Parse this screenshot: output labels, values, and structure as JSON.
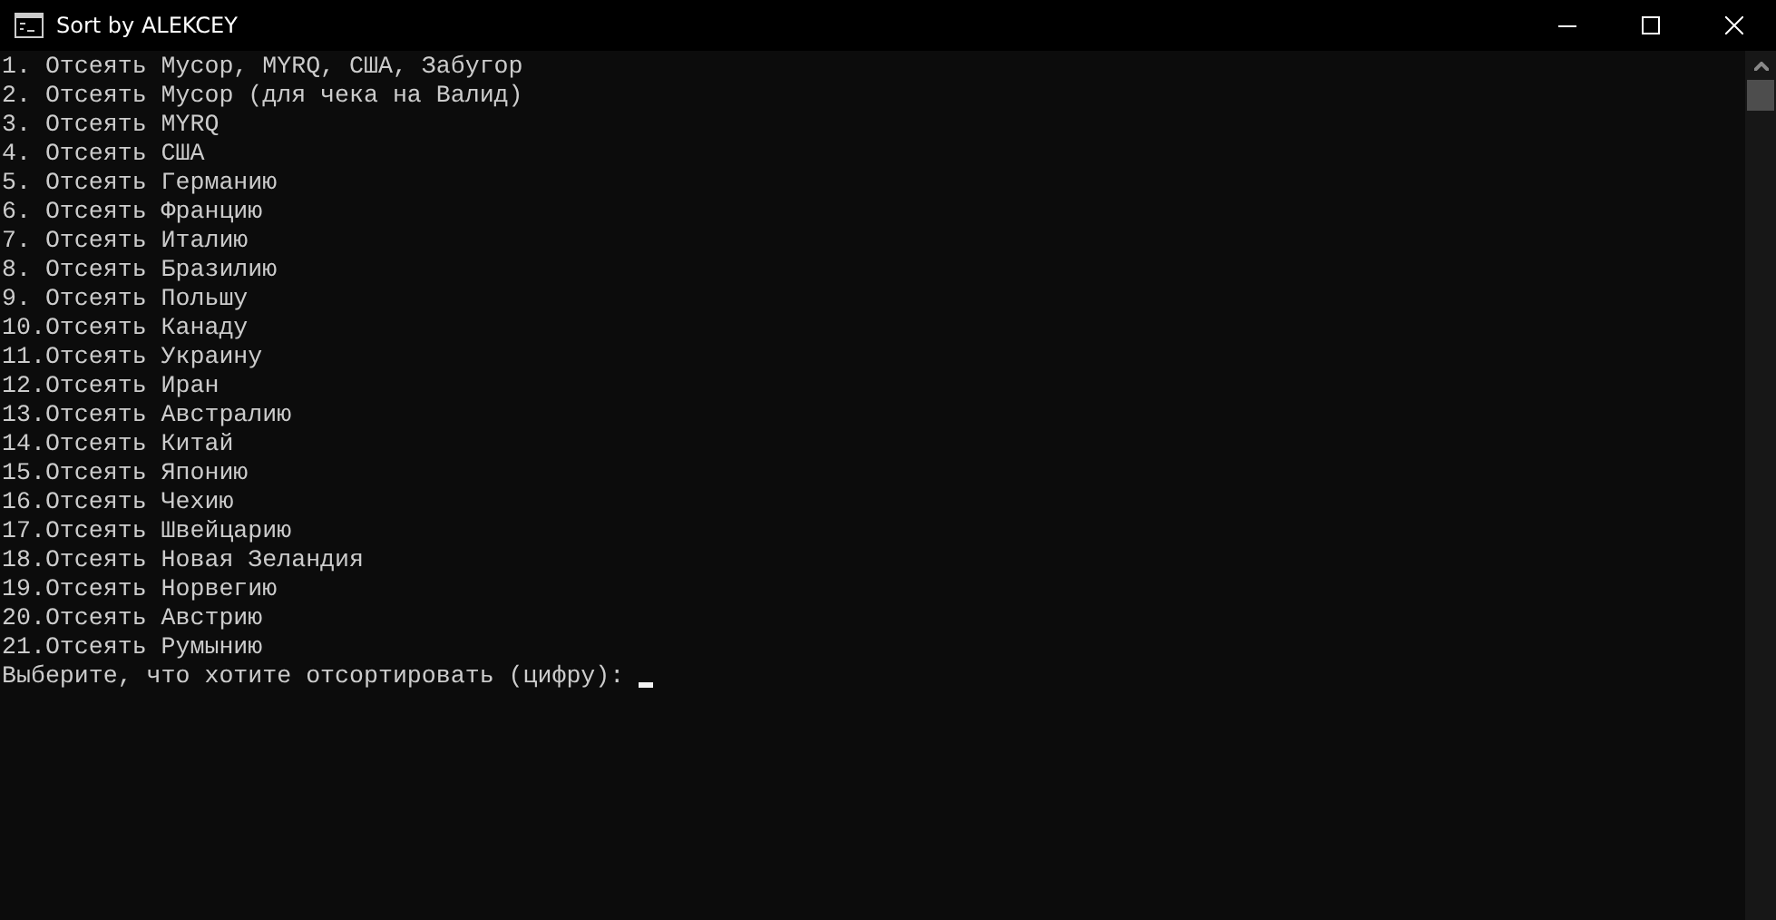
{
  "window": {
    "title": "Sort by ALEKCEY"
  },
  "console": {
    "lines": [
      "1. Отсеять Мусор, MYRQ, США, Забугор",
      "2. Отсеять Мусор (для чека на Валид)",
      "3. Отсеять MYRQ",
      "4. Отсеять США",
      "5. Отсеять Германию",
      "6. Отсеять Францию",
      "7. Отсеять Италию",
      "8. Отсеять Бразилию",
      "9. Отсеять Польшу",
      "10.Отсеять Канаду",
      "11.Отсеять Украину",
      "12.Отсеять Иран",
      "13.Отсеять Австралию",
      "14.Отсеять Китай",
      "15.Отсеять Японию",
      "16.Отсеять Чехию",
      "17.Отсеять Швейцарию",
      "18.Отсеять Новая Зеландия",
      "19.Отсеять Норвегию",
      "20.Отсеять Австрию",
      "21.Отсеять Румынию"
    ],
    "prompt": "Выберите, что хотите отсортировать (цифру):"
  }
}
